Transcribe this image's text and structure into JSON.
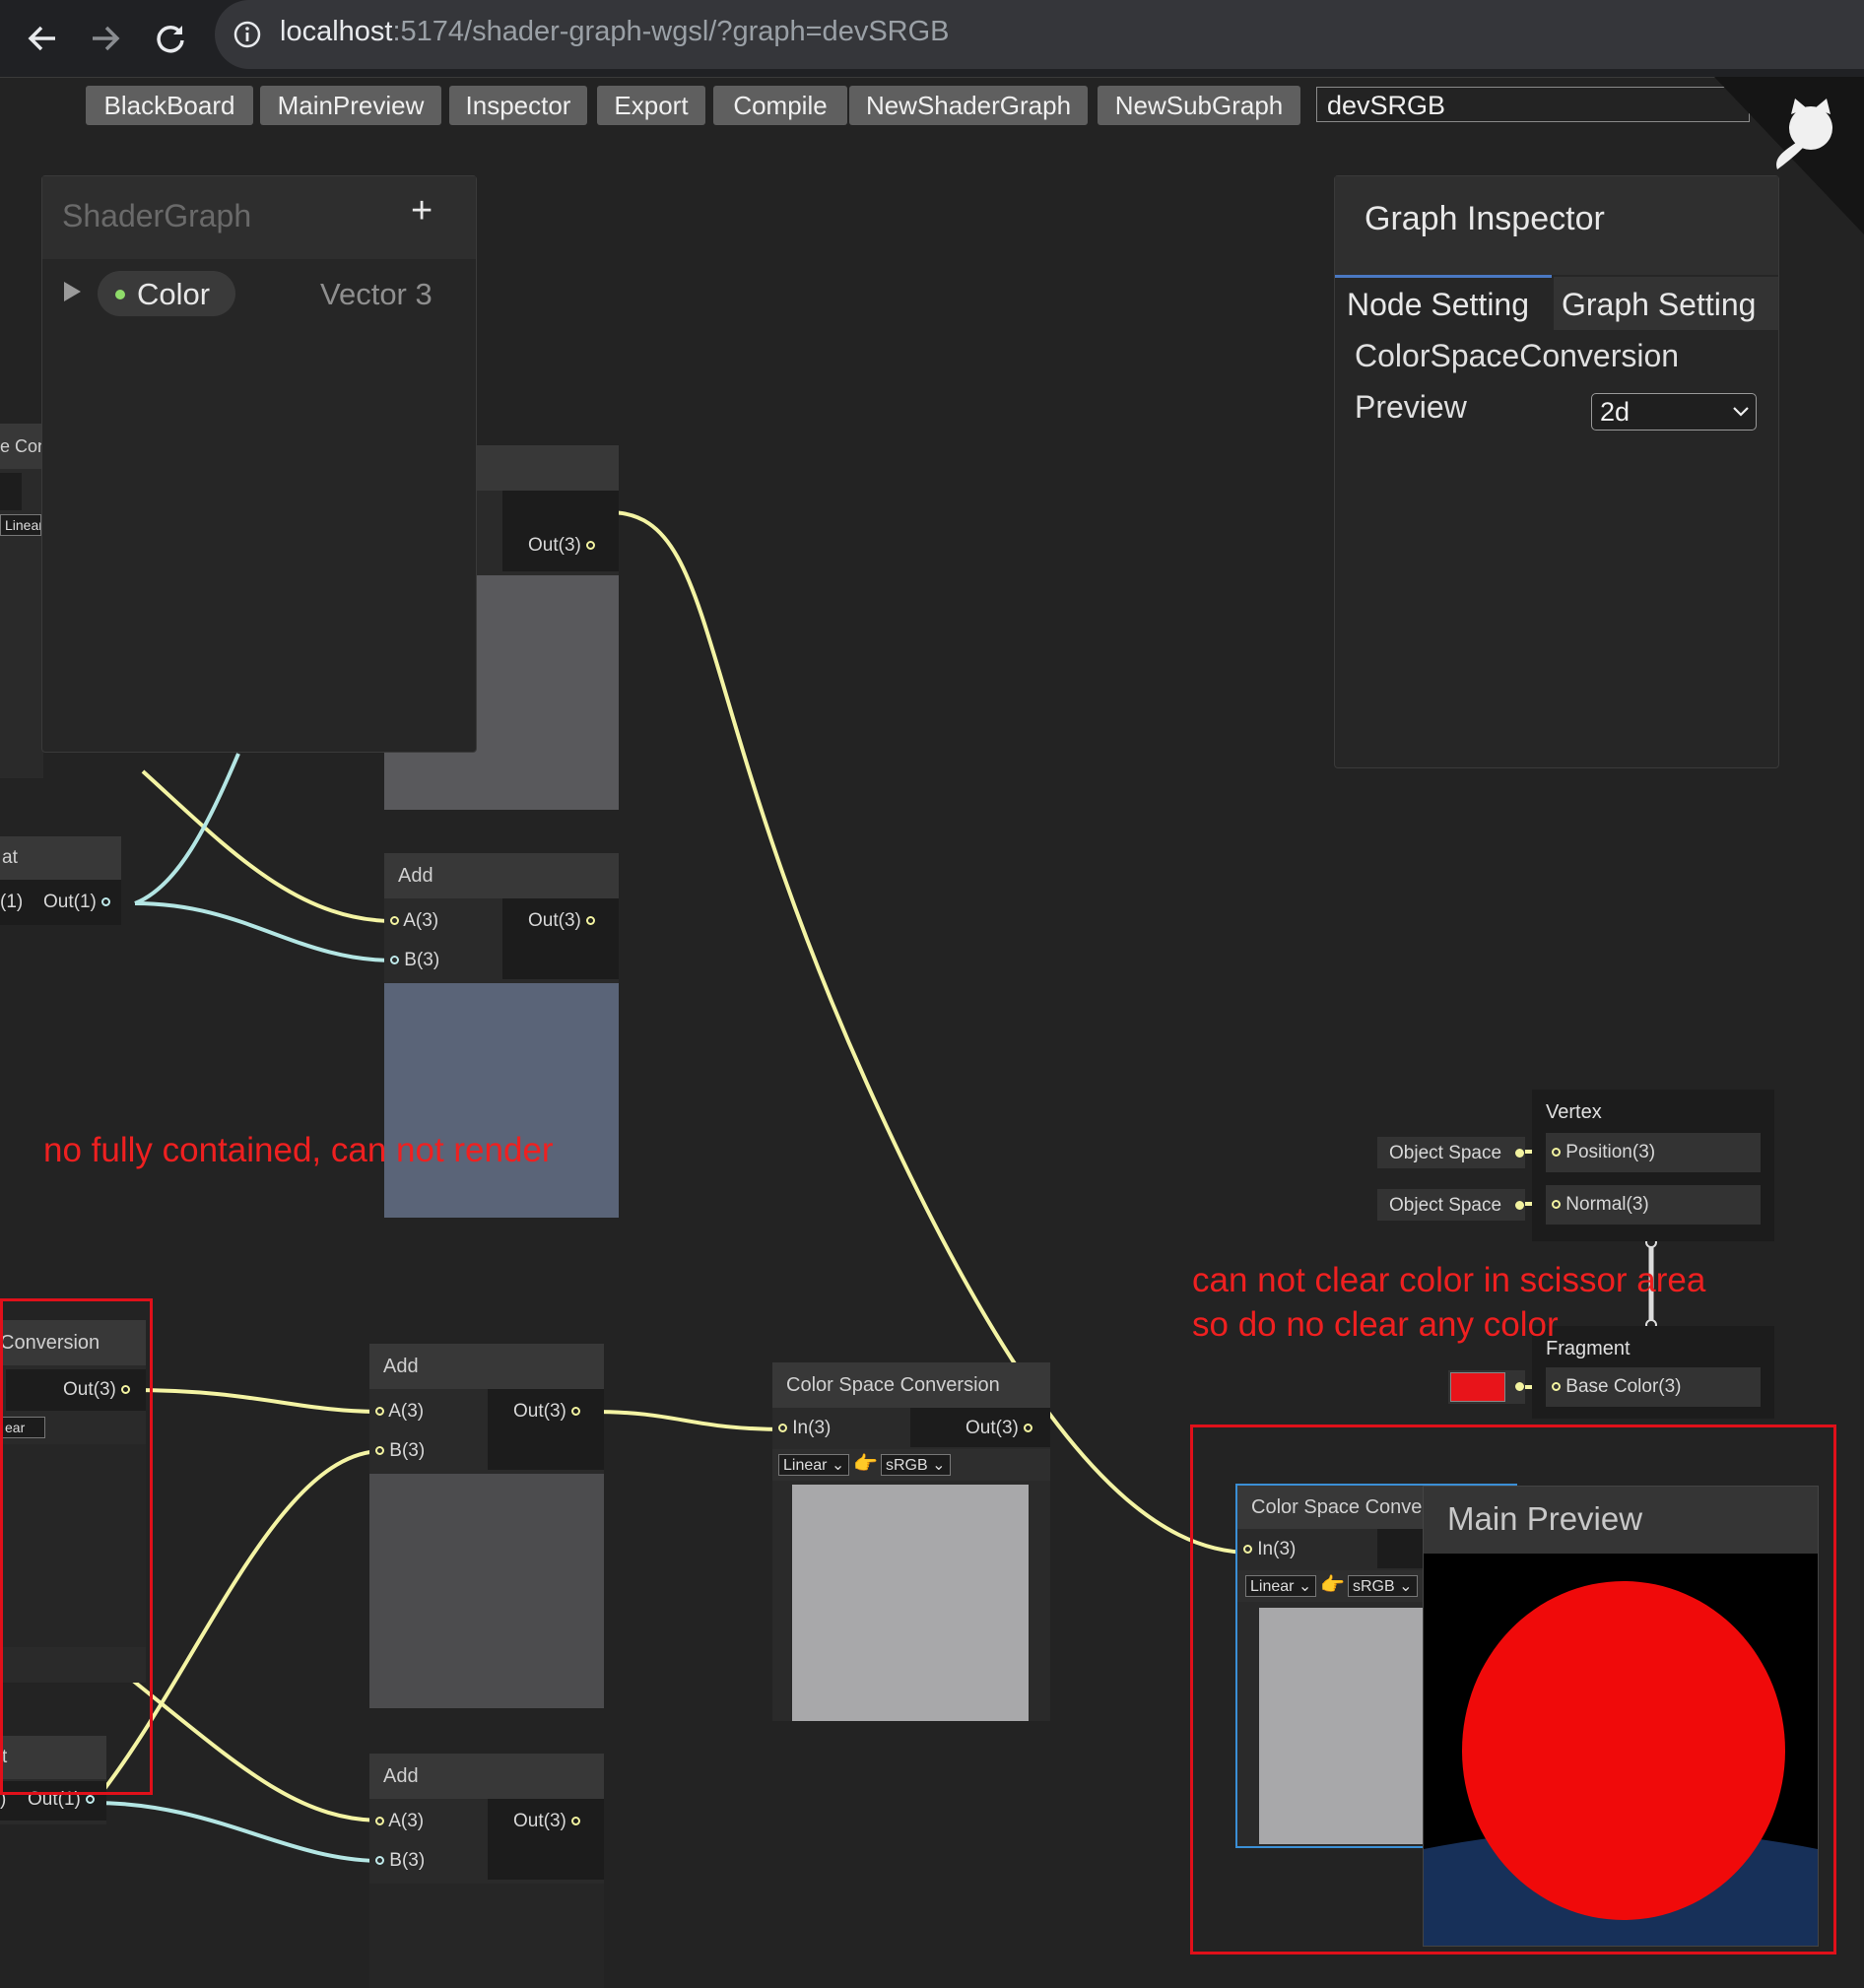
{
  "browser": {
    "url_host": "localhost",
    "url_rest": ":5174/shader-graph-wgsl/?graph=devSRGB"
  },
  "toolbar": {
    "buttons": [
      "BlackBoard",
      "MainPreview",
      "Inspector",
      "Export",
      "Compile",
      "NewShaderGraph",
      "NewSubGraph"
    ],
    "graph_name": "devSRGB"
  },
  "blackboard": {
    "title": "ShaderGraph",
    "add_label": "+",
    "property_name": "Color",
    "property_type": "Vector 3"
  },
  "inspector": {
    "title": "Graph Inspector",
    "tabs": [
      "Node Setting",
      "Graph Setting"
    ],
    "active_tab": "Node Setting",
    "node_name": "ColorSpaceConversion",
    "preview_label": "Preview",
    "preview_value": "2d"
  },
  "nodes": {
    "partial_csc_top": {
      "title_fragment": "e Con",
      "dropdown_fragment": "Linear"
    },
    "top_out": {
      "out": "Out(3)"
    },
    "partial_float_top": {
      "title_fragment": "at",
      "in_fragment": "(1)",
      "out": "Out(1)"
    },
    "add1": {
      "title": "Add",
      "a": "A(3)",
      "b": "B(3)",
      "out": "Out(3)"
    },
    "partial_csc_bottom": {
      "title_fragment": "Conversion",
      "out": "Out(3)",
      "dropdown_fragment": "ear"
    },
    "partial_float_bottom": {
      "title_fragment": "t",
      "in_fragment": ")",
      "out": "Out(1)"
    },
    "add2": {
      "title": "Add",
      "a": "A(3)",
      "b": "B(3)",
      "out": "Out(3)"
    },
    "add3": {
      "title": "Add",
      "a": "A(3)",
      "b": "B(3)",
      "out": "Out(3)"
    },
    "csc_mid": {
      "title": "Color Space Conversion",
      "in": "In(3)",
      "out": "Out(3)",
      "from": "Linear",
      "to": "sRGB"
    },
    "csc_right": {
      "title": "Color Space Conve",
      "in": "In(3)",
      "from": "Linear",
      "to": "sRGB"
    },
    "vertex": {
      "title": "Vertex",
      "position": "Position(3)",
      "normal": "Normal(3)",
      "space1": "Object Space",
      "space2": "Object Space"
    },
    "fragment": {
      "title": "Fragment",
      "base_color": "Base Color(3)",
      "swatch_color": "#e8141a"
    }
  },
  "main_preview": {
    "title": "Main Preview"
  },
  "annotations": {
    "note1": "no fully contained, can not render",
    "note2_line1": "can not clear color in scissor area",
    "note2_line2": "so do no clear any color"
  },
  "colors": {
    "edge_yellow": "#f4f4a4",
    "edge_cyan": "#b4e6e4",
    "annotation_red": "#ef2020",
    "sphere_red": "#f00a0a",
    "preview_floor": "#173059"
  }
}
